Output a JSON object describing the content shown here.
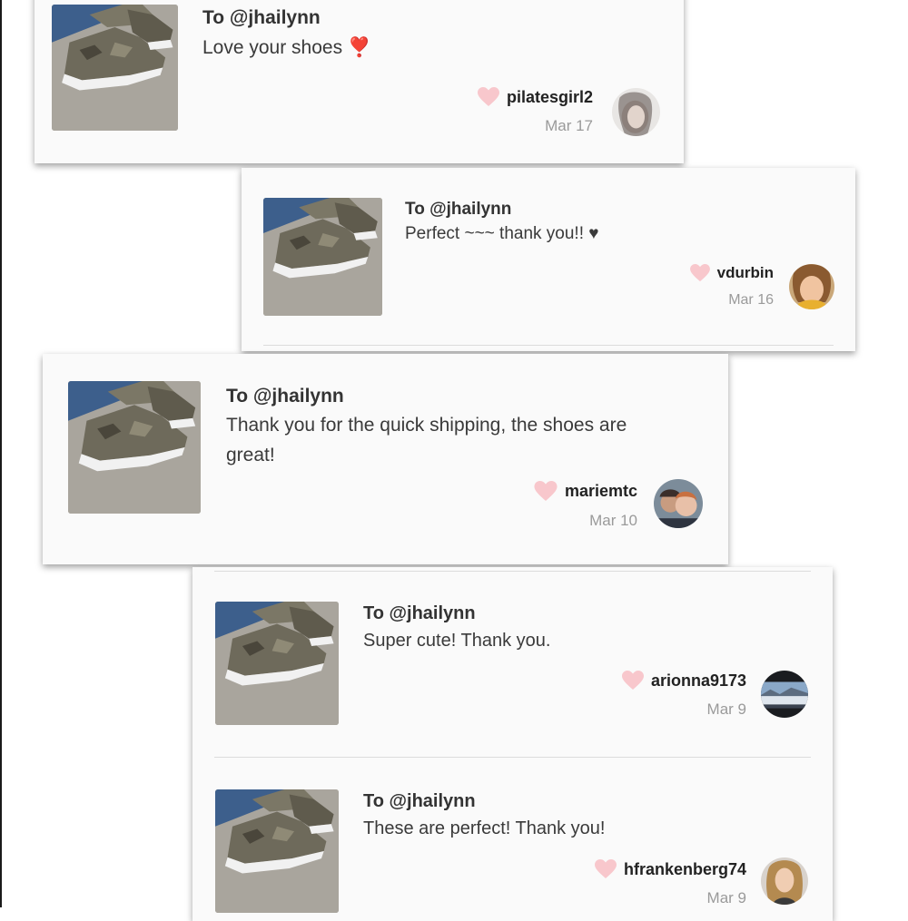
{
  "colors": {
    "card_bg": "#fafafa",
    "heart": "#f8c7cc",
    "date_text": "#9a9a9a"
  },
  "icons": {
    "like": "heart-icon"
  },
  "reviews": [
    {
      "to": "To @jhailynn",
      "message": "Love your shoes ❣️",
      "username": "pilatesgirl2",
      "date": "Mar 17",
      "avatar": "avatar-photo"
    },
    {
      "to": "To @jhailynn",
      "message": "Perfect ~~~ thank you!! ♥",
      "username": "vdurbin",
      "date": "Mar 16",
      "avatar": "avatar-photo"
    },
    {
      "to": "To @jhailynn",
      "message": "Thank you for the quick shipping, the shoes are great!",
      "username": "mariemtc",
      "date": "Mar 10",
      "avatar": "avatar-couple-photo"
    },
    {
      "to": "To @jhailynn",
      "message": "Super cute! Thank you.",
      "username": "arionna9173",
      "date": "Mar 9",
      "avatar": "avatar-landscape-photo"
    },
    {
      "to": "To @jhailynn",
      "message": "These are perfect! Thank you!",
      "username": "hfrankenberg74",
      "date": "Mar 9",
      "avatar": "avatar-photo"
    }
  ]
}
